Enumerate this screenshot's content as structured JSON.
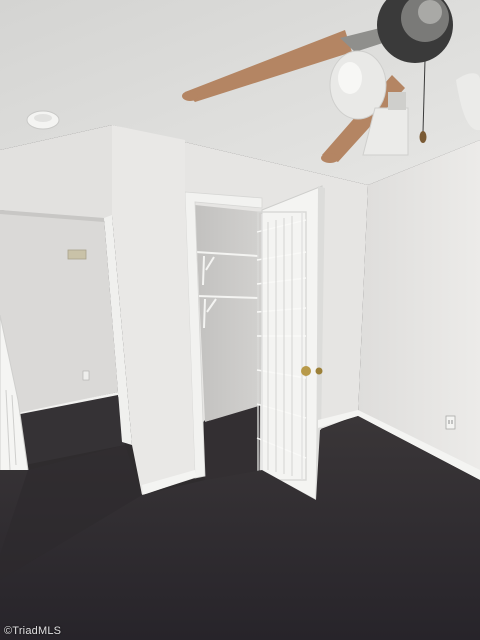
{
  "photo": {
    "subject": "empty-bedroom-with-open-closet-and-ceiling-fan",
    "watermark": "©TriadMLS"
  },
  "colors": {
    "ceiling": "#dcdcda",
    "wall_light": "#e4e3e1",
    "wall_shadow": "#c9c8c6",
    "carpet": "#2f2c2e",
    "trim": "#f2f2f0",
    "fan_blade": "#b48563"
  }
}
